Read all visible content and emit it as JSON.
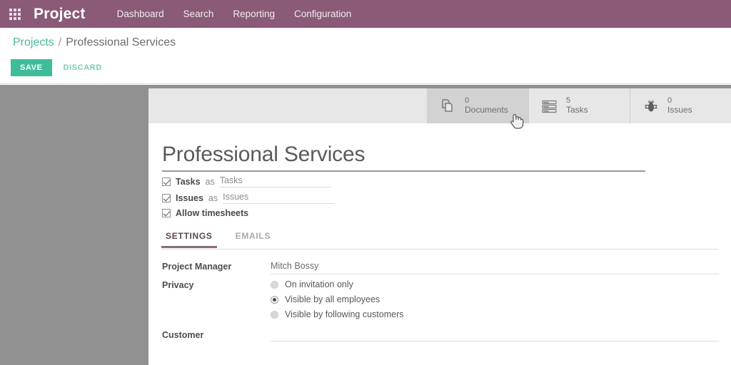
{
  "navbar": {
    "apps_icon": "apps-grid-icon",
    "brand": "Project",
    "menu": [
      {
        "label": "Dashboard"
      },
      {
        "label": "Search"
      },
      {
        "label": "Reporting"
      },
      {
        "label": "Configuration"
      }
    ],
    "background_color": "#8a5a77"
  },
  "control_panel": {
    "breadcrumb": {
      "root": "Projects",
      "separator": "/",
      "current": "Professional Services"
    },
    "save_label": "SAVE",
    "discard_label": "DISCARD",
    "save_color": "#3fbd9a",
    "discard_color": "#7ec9b4",
    "breadcrumb_link_color": "#4ab89a"
  },
  "form": {
    "title": "Professional Services",
    "stat_buttons": [
      {
        "value": "0",
        "label": "Documents",
        "icon": "documents-icon",
        "active": true
      },
      {
        "value": "5",
        "label": "Tasks",
        "icon": "list-icon",
        "active": false
      },
      {
        "value": "0",
        "label": "Issues",
        "icon": "bug-icon",
        "active": false
      }
    ],
    "checkboxes": [
      {
        "label": "Tasks",
        "connector": "as",
        "value": "Tasks",
        "checked": true,
        "has_field": true
      },
      {
        "label": "Issues",
        "connector": "as",
        "value": "Issues",
        "checked": true,
        "has_field": true
      },
      {
        "label": "Allow timesheets",
        "connector": "",
        "value": "",
        "checked": true,
        "has_field": false
      }
    ],
    "tabs": [
      {
        "label": "SETTINGS",
        "active": true
      },
      {
        "label": "EMAILS",
        "active": false
      }
    ],
    "fields": {
      "project_manager": {
        "label": "Project Manager",
        "value": "Mitch Bossy"
      },
      "privacy": {
        "label": "Privacy",
        "options": [
          {
            "label": "On invitation only",
            "selected": false
          },
          {
            "label": "Visible by all employees",
            "selected": true
          },
          {
            "label": "Visible by following customers",
            "selected": false
          }
        ]
      },
      "customer": {
        "label": "Customer",
        "value": ""
      }
    }
  },
  "cursor": {
    "type": "pointer-hand-cursor"
  }
}
